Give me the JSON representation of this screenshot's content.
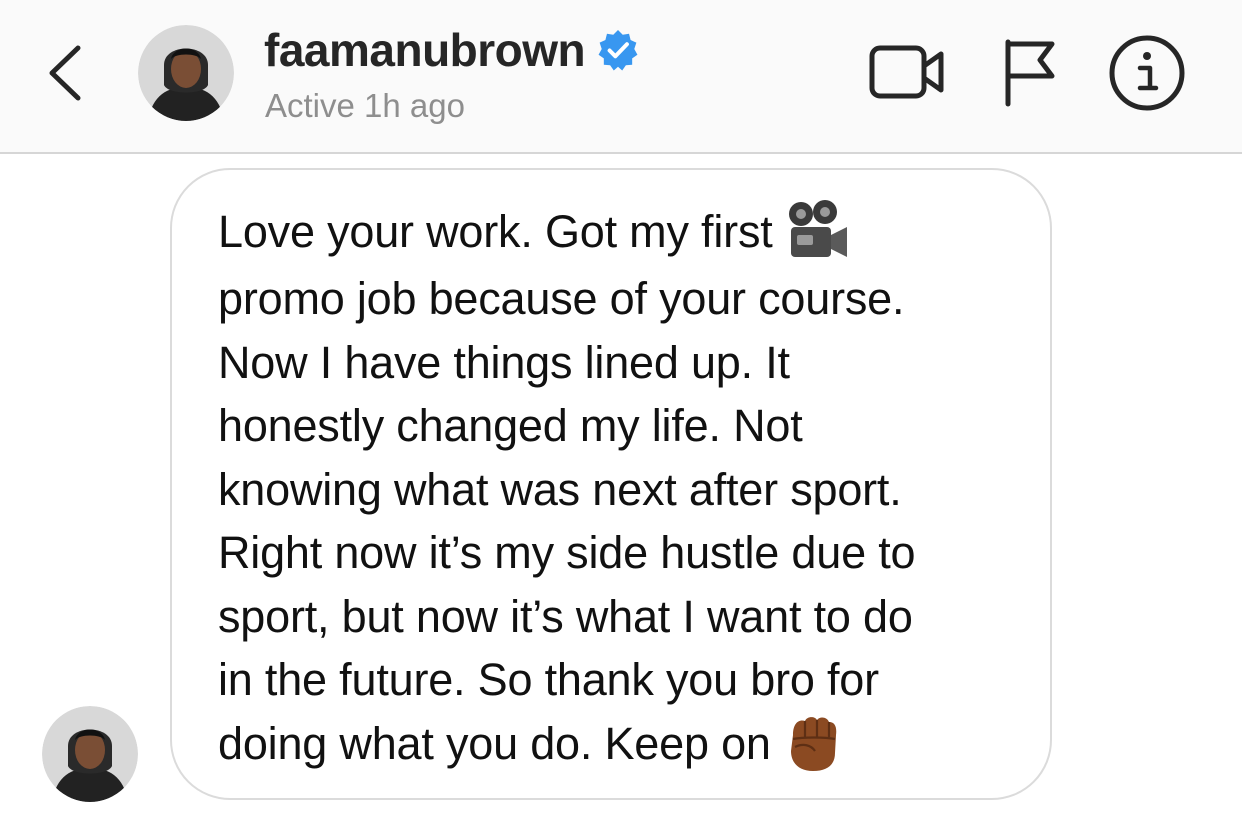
{
  "header": {
    "username": "faamanubrown",
    "status": "Active 1h ago",
    "back_icon": "chevron-left-icon",
    "verified_icon": "verified-badge-icon",
    "actions": [
      "video-camera-icon",
      "flag-icon",
      "info-icon"
    ]
  },
  "message": {
    "lines": [
      "Love your work. Got my first",
      "promo job because of your course.",
      "Now I have things lined up. It",
      "honestly changed my life. Not",
      "knowing what was next after sport.",
      "Right now it’s my side hustle due to",
      "sport, but now it’s what I want to do",
      "in the future. So thank you bro for",
      "doing what you do. Keep on"
    ],
    "emojis": [
      "movie-camera-emoji",
      "raised-fist-emoji"
    ]
  },
  "colors": {
    "header_bg": "#fafafa",
    "verified_blue": "#3897f0",
    "status_gray": "#8e8e8e",
    "bubble_border": "#dbdbdb",
    "fist_brown": "#8b4a22"
  }
}
